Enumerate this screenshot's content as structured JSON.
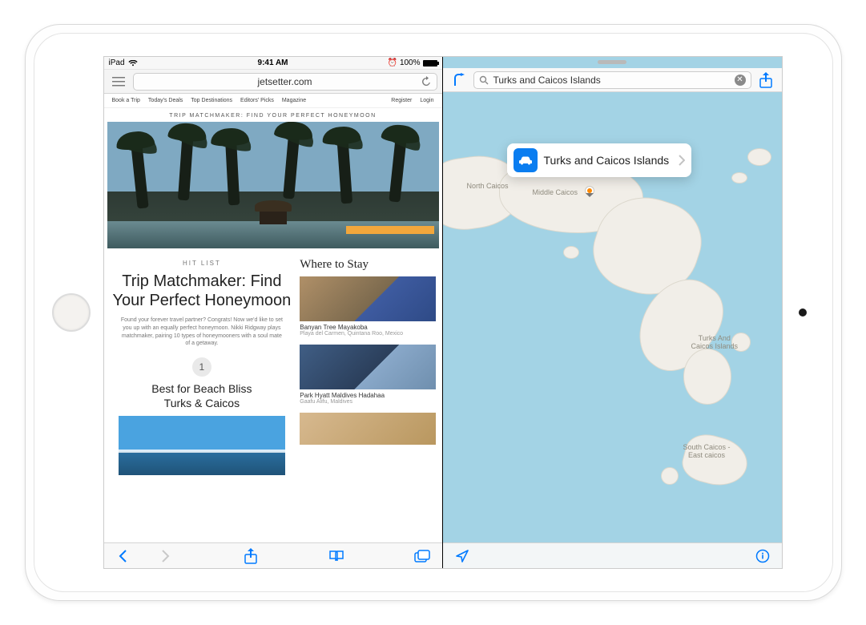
{
  "status": {
    "carrier": "iPad",
    "time": "9:41 AM",
    "battery_text": "100%"
  },
  "safari": {
    "host": "jetsetter.com",
    "nav": {
      "book": "Book a Trip",
      "deals": "Today's Deals",
      "dest": "Top Destinations",
      "picks": "Editors' Picks",
      "mag": "Magazine",
      "register": "Register",
      "login": "Login"
    },
    "banner": "TRIP MATCHMAKER: FIND YOUR PERFECT HONEYMOON",
    "kicker": "HIT LIST",
    "headline": "Trip Matchmaker: Find Your Perfect Honeymoon",
    "dek": "Found your forever travel partner? Congrats! Now we'd like to set you up with an equally perfect honeymoon. Nikki Ridgway plays matchmaker, pairing 10 types of honeymooners with a soul mate of a getaway.",
    "step": "1",
    "subhead": "Best for Beach Bliss\nTurks & Caicos",
    "sidehead": "Where to Stay",
    "cards": [
      {
        "title": "Banyan Tree Mayakoba",
        "sub": "Playa del Carmen, Quintana Roo, Mexico"
      },
      {
        "title": "Park Hyatt Maldives Hadahaa",
        "sub": "Gaafu Alifu, Maldives"
      }
    ]
  },
  "maps": {
    "search_value": "Turks and Caicos Islands",
    "callout_label": "Turks and Caicos Islands",
    "labels": {
      "north": "North Caicos",
      "middle": "Middle Caicos",
      "tci": "Turks And\nCaicos Islands",
      "south": "South Caicos -\nEast caicos"
    }
  }
}
